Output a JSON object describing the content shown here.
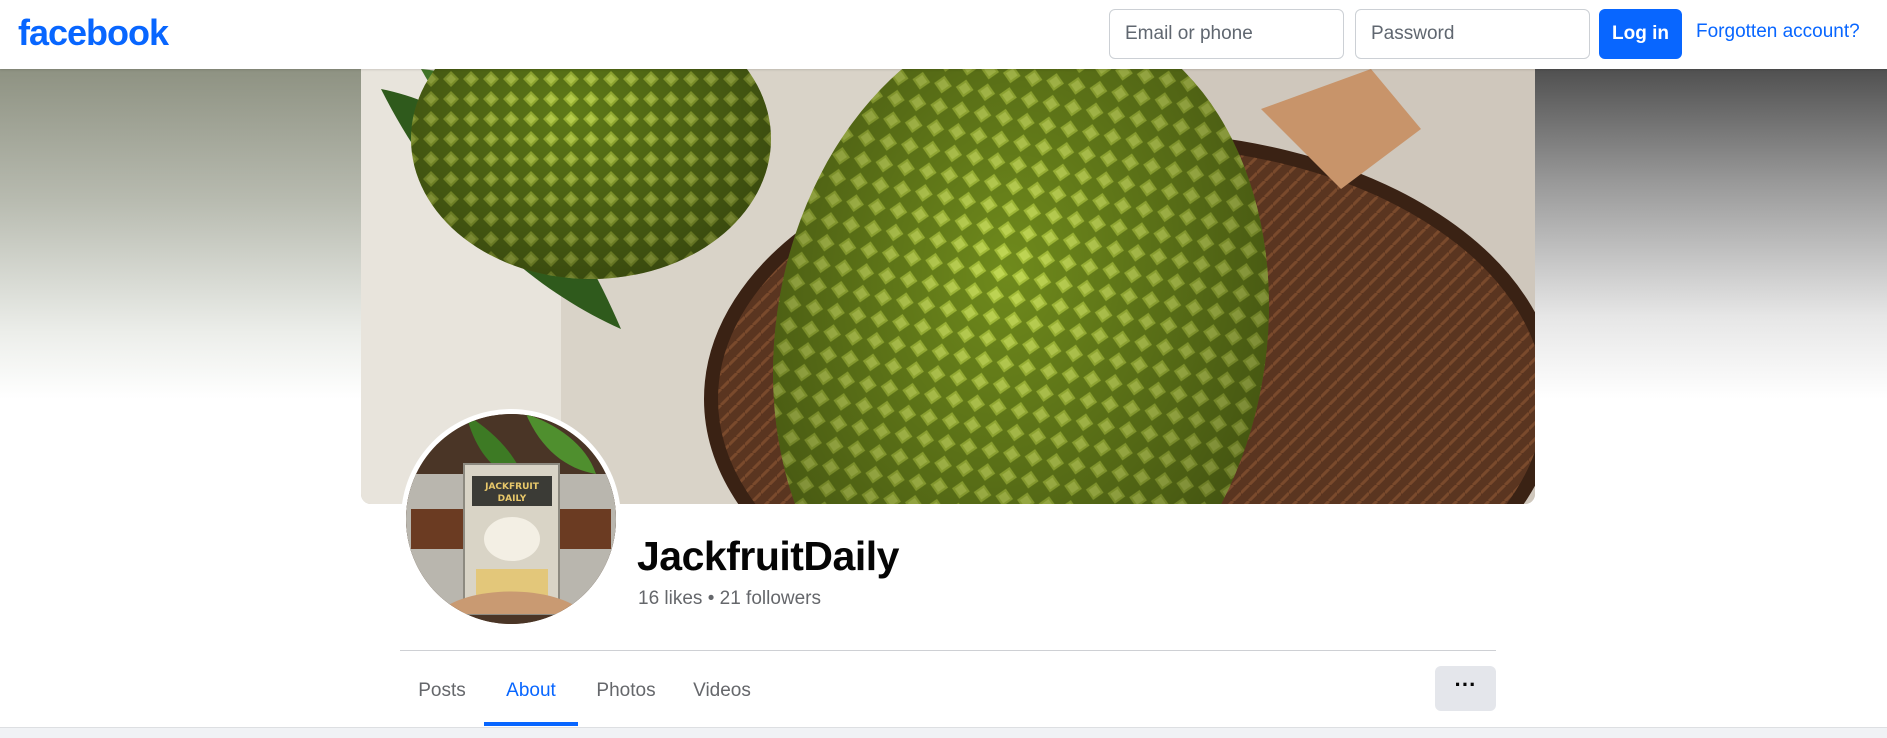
{
  "nav": {
    "logo": "facebook",
    "email_placeholder": "Email or phone",
    "password_placeholder": "Password",
    "login_label": "Log in",
    "forgot_label": "Forgotten account?"
  },
  "profile": {
    "name": "JackfruitDaily",
    "stats": "16 likes • 21 followers"
  },
  "tabs": [
    {
      "label": "Posts",
      "active": false
    },
    {
      "label": "About",
      "active": true
    },
    {
      "label": "Photos",
      "active": false
    },
    {
      "label": "Videos",
      "active": false
    }
  ],
  "more_button": "···",
  "colors": {
    "brand": "#0866ff",
    "muted_text": "#65676b",
    "button_bg": "#e4e6eb"
  }
}
